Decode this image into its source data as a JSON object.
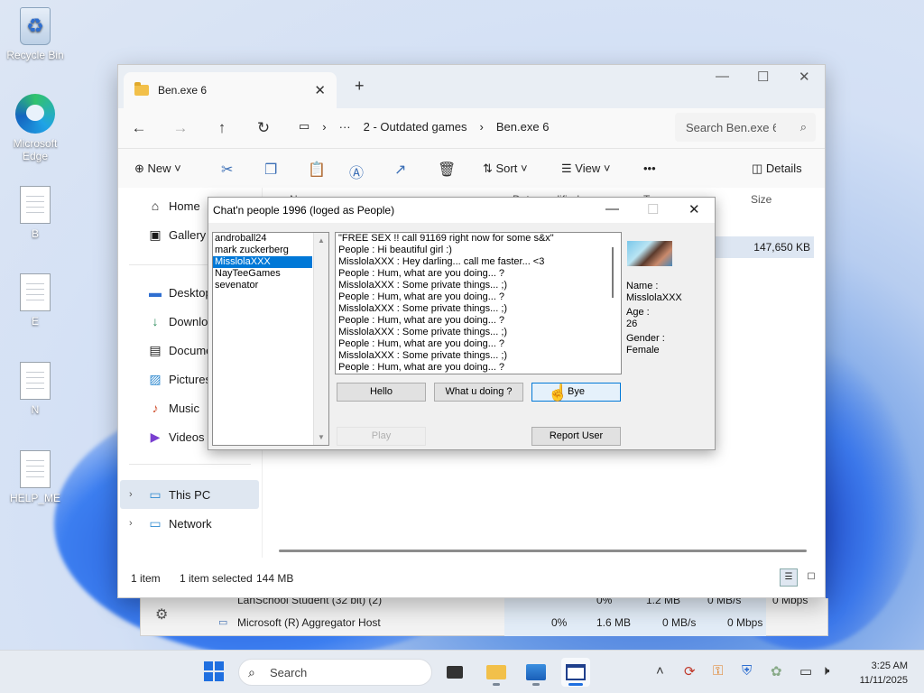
{
  "desktop": {
    "icons": [
      {
        "label": "Recycle Bin",
        "icon": "recycle-bin-icon"
      },
      {
        "label": "Microsoft Edge",
        "icon": "edge-icon"
      },
      {
        "label": "B",
        "icon": "document-icon"
      },
      {
        "label": "E",
        "icon": "document-icon"
      },
      {
        "label": "N",
        "icon": "document-icon"
      },
      {
        "label": "HELP_ME",
        "icon": "document-icon"
      }
    ]
  },
  "explorer": {
    "tab_title": "Ben.exe 6",
    "breadcrumbs": [
      "2 - Outdated games",
      "Ben.exe 6"
    ],
    "ellipsis": "···",
    "search_placeholder": "Search Ben.exe 6",
    "commands": {
      "new": "New",
      "sort": "Sort",
      "view": "View",
      "more": "•••",
      "details": "Details"
    },
    "nav": {
      "home": "Home",
      "gallery": "Gallery",
      "desktop": "Desktop",
      "downloads": "Downloads",
      "documents": "Documents",
      "pictures": "Pictures",
      "music": "Music",
      "videos": "Videos",
      "this_pc": "This PC",
      "network": "Network"
    },
    "columns": {
      "name": "Name",
      "date_modified": "Date modified",
      "type": "Type",
      "size": "Size"
    },
    "file_size": "147,650 KB",
    "status": {
      "count": "1 item",
      "selected": "1 item selected",
      "selected_size": "144 MB"
    }
  },
  "taskmgr": {
    "rows": [
      {
        "name": "LanSchool Student (32 bit) (2)",
        "cpu": "0%",
        "mem": "1.2 MB",
        "disk": "0 MB/s",
        "net": "0 Mbps"
      },
      {
        "name": "Microsoft (R) Aggregator Host",
        "cpu": "0%",
        "mem": "1.6 MB",
        "disk": "0 MB/s",
        "net": "0 Mbps"
      }
    ]
  },
  "chat": {
    "title": "Chat'n people 1996 (loged as People)",
    "users": [
      "androball24",
      "mark zuckerberg",
      "MisslolaXXX",
      "NayTeeGames",
      "sevenator"
    ],
    "selected_user": "MisslolaXXX",
    "messages": [
      "\"FREE SEX !! call 91169 right now for some s&x\"",
      "People : Hi beautiful girl :)",
      "MisslolaXXX : Hey darling... call me faster... <3",
      "People : Hum, what are you doing... ?",
      "MisslolaXXX : Some private things... ;)",
      "People : Hum, what are you doing... ?",
      "MisslolaXXX : Some private things... ;)",
      "People : Hum, what are you doing... ?",
      "MisslolaXXX : Some private things... ;)",
      "People : Hum, what are you doing... ?",
      "MisslolaXXX : Some private things... ;)",
      "People : Hum, what are you doing... ?"
    ],
    "buttons": {
      "hello": "Hello",
      "what": "What u doing ?",
      "bye": "Bye",
      "play": "Play",
      "report": "Report User"
    },
    "profile": {
      "name_label": "Name :",
      "name": "MisslolaXXX",
      "age_label": "Age :",
      "age": "26",
      "gender_label": "Gender :",
      "gender": "Female"
    }
  },
  "taskbar": {
    "search": "Search",
    "time": "3:25 AM",
    "date": "11/11/2025"
  }
}
